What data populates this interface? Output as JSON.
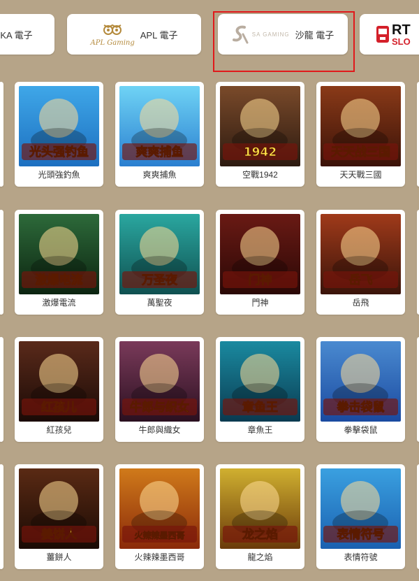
{
  "tabs": [
    {
      "id": "ka",
      "label": "KA 電子",
      "logo_text": "g"
    },
    {
      "id": "apl",
      "label": "APL 電子",
      "logo_text": "APL Gaming"
    },
    {
      "id": "sa",
      "label": "沙龍 電子",
      "logo_text": "SA GAMING"
    },
    {
      "id": "rt",
      "label": "",
      "logo_big": "RT",
      "logo_small": "SLO"
    }
  ],
  "games": [
    {
      "name": "光頭強釣魚",
      "thumb_title": "光头强钓鱼",
      "colors": [
        "#3fa7e8",
        "#1c6fc0"
      ]
    },
    {
      "name": "爽爽捕魚",
      "thumb_title": "爽爽捕鱼",
      "colors": [
        "#6fd3f5",
        "#2a7fd0"
      ]
    },
    {
      "name": "空戰1942",
      "thumb_title": "1942",
      "colors": [
        "#7a4a2a",
        "#2c1a10"
      ]
    },
    {
      "name": "天天戰三國",
      "thumb_title": "天天战三国",
      "colors": [
        "#8a3a18",
        "#3a1208"
      ]
    },
    {
      "name": "激爆電流",
      "thumb_title": "激爆电流",
      "colors": [
        "#2d6a3a",
        "#0c2410"
      ]
    },
    {
      "name": "萬聖夜",
      "thumb_title": "万圣夜",
      "colors": [
        "#2aa7a0",
        "#0f5050"
      ]
    },
    {
      "name": "門神",
      "thumb_title": "门神",
      "colors": [
        "#6a1a14",
        "#2a0806"
      ]
    },
    {
      "name": "岳飛",
      "thumb_title": "岳飞",
      "colors": [
        "#a03a1a",
        "#3a140a"
      ]
    },
    {
      "name": "紅孩兒",
      "thumb_title": "红孩儿",
      "colors": [
        "#5a2a1a",
        "#1a0a06"
      ]
    },
    {
      "name": "牛郎與織女",
      "thumb_title": "牛郎与织女",
      "colors": [
        "#7a3a5a",
        "#2a1020"
      ]
    },
    {
      "name": "章魚王",
      "thumb_title": "章鱼王",
      "colors": [
        "#1a8aa0",
        "#0a3a50"
      ]
    },
    {
      "name": "拳擊袋鼠",
      "thumb_title": "拳击袋鼠",
      "colors": [
        "#4a8ad0",
        "#1a4aa0"
      ]
    },
    {
      "name": "薑餅人",
      "thumb_title": "姜饼人",
      "colors": [
        "#5a2a14",
        "#1a0a04"
      ]
    },
    {
      "name": "火辣辣墨西哥",
      "thumb_title": "火辣辣墨西哥",
      "colors": [
        "#d07a1a",
        "#8a2a0a"
      ]
    },
    {
      "name": "龍之焰",
      "thumb_title": "龙之焰",
      "colors": [
        "#d0b030",
        "#6a3a0a"
      ]
    },
    {
      "name": "表情符號",
      "thumb_title": "表情符号",
      "colors": [
        "#3aa0e0",
        "#1a60b0"
      ]
    }
  ],
  "palette": {
    "background": "#b6a488",
    "highlight": "#e0191b"
  }
}
